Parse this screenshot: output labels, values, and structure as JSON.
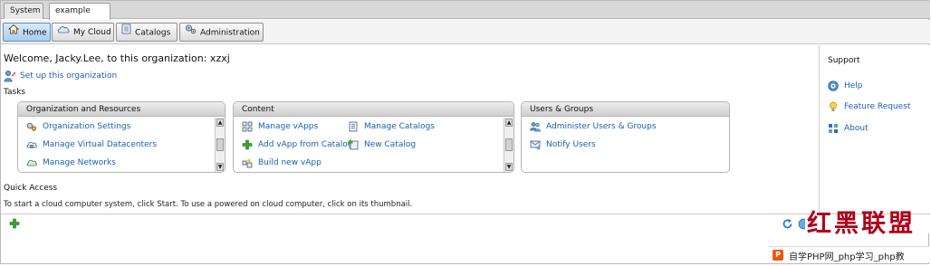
{
  "window_tabs": [
    {
      "label": "System"
    },
    {
      "label": "example",
      "close": "✕"
    }
  ],
  "nav": [
    {
      "label": "Home",
      "icon": "home-icon",
      "active": true
    },
    {
      "label": "My Cloud",
      "icon": "cloud-icon",
      "active": false
    },
    {
      "label": "Catalogs",
      "icon": "catalog-icon",
      "active": false
    },
    {
      "label": "Administration",
      "icon": "gears-icon",
      "active": false
    }
  ],
  "welcome": "Welcome, Jacky.Lee, to this organization: xzxj",
  "setup_link": "Set up this organization",
  "tasks_label": "Tasks",
  "panels": {
    "org": {
      "title": "Organization and Resources",
      "items": [
        "Organization Settings",
        "Manage Virtual Datacenters",
        "Manage Networks"
      ]
    },
    "content": {
      "title": "Content",
      "left_items": [
        "Manage vApps",
        "Add vApp from Catalog",
        "Build new vApp"
      ],
      "right_items": [
        "Manage Catalogs",
        "New Catalog"
      ]
    },
    "users": {
      "title": "Users & Groups",
      "items": [
        "Administer Users & Groups",
        "Notify Users"
      ]
    }
  },
  "quick_access": {
    "label": "Quick Access",
    "text": "To start a cloud computer system, click Start. To use a powered on cloud computer, click on its thumbnail."
  },
  "support": {
    "title": "Support",
    "items": [
      "Help",
      "Feature Request",
      "About"
    ]
  },
  "watermark": {
    "title": "红黑联盟",
    "strip_logo": "P",
    "strip_text": "自学PHP网_php学习_php教"
  },
  "colors": {
    "link": "#1a5fb4",
    "active_tab": "#a7cdee",
    "watermark_red": "#b0001a"
  }
}
